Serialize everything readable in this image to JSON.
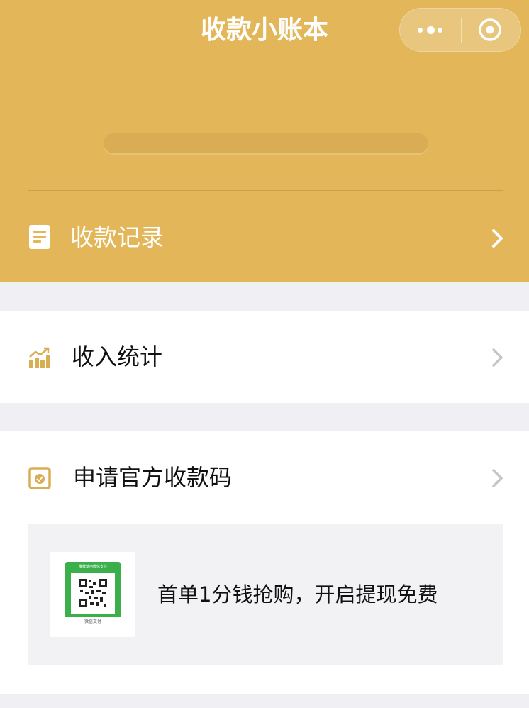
{
  "header": {
    "title": "收款小账本",
    "background": "#e2b659"
  },
  "capsule": {
    "menu_icon": "more-dots-icon",
    "close_icon": "target-icon"
  },
  "record": {
    "label": "收款记录",
    "icon": "document-icon"
  },
  "stats": {
    "label": "收入统计",
    "icon": "bar-chart-icon"
  },
  "apply": {
    "label": "申请官方收款码",
    "icon": "qr-badge-icon",
    "promo": {
      "text": "首单1分钱抢购，开启提现免费",
      "qr_top_text": "推荐使用微信支付",
      "qr_bottom_text": "微信支付"
    }
  },
  "colors": {
    "accent": "#e2b659",
    "icon_gold": "#d9ad52",
    "chevron": "#c6c6c8"
  }
}
